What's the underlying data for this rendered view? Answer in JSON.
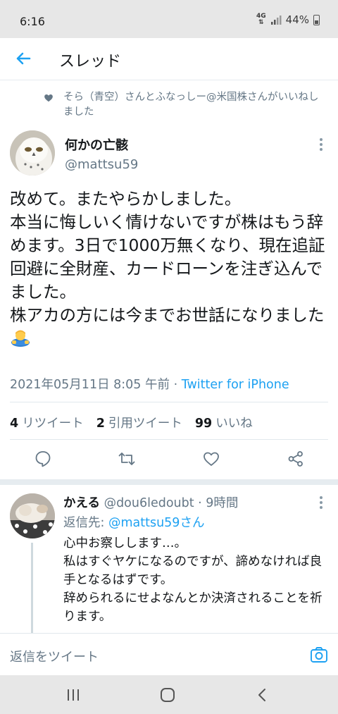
{
  "status_bar": {
    "time": "6:16",
    "network_top": "4G",
    "network_bottom": "⇅",
    "battery": "44%"
  },
  "header": {
    "title": "スレッド",
    "back_icon": "arrow-left-icon"
  },
  "liked_by": "そら（青空）さんとふなっしー@米国株さんがいいねしました",
  "tweet": {
    "author_name": "何かの亡骸",
    "author_handle": "@mattsu59",
    "text": "改めて。またやらかしました。\n本当に悔しいく情けないですが株はもう辞めます。3日で1000万無くなり、現在追証回避に全財産、カードローンを注ぎ込んでました。\n株アカの方には今までお世話になりました",
    "emoji": "person-bowing-emoji",
    "date": "2021年05月11日 8:05 午前",
    "separator": " · ",
    "source": "Twitter for iPhone",
    "stats": {
      "retweets_count": "4",
      "retweets_label": "リツイート",
      "quotes_count": "2",
      "quotes_label": "引用ツイート",
      "likes_count": "99",
      "likes_label": "いいね"
    }
  },
  "reply": {
    "name": "かえる",
    "handle_time": "@dou6ledoubt · 9時間",
    "reply_to_prefix": "返信先: ",
    "reply_to_mention": "@mattsu59さん",
    "text": "心中お察しします…。\n私はすぐヤケになるのですが、諦めなければ良手となるはずです。\n辞められるにせよなんとか決済されることを祈ります。"
  },
  "compose": {
    "placeholder": "返信をツイート"
  },
  "colors": {
    "accent": "#1da1f2",
    "secondary_text": "#657786",
    "primary_text": "#14171a"
  }
}
